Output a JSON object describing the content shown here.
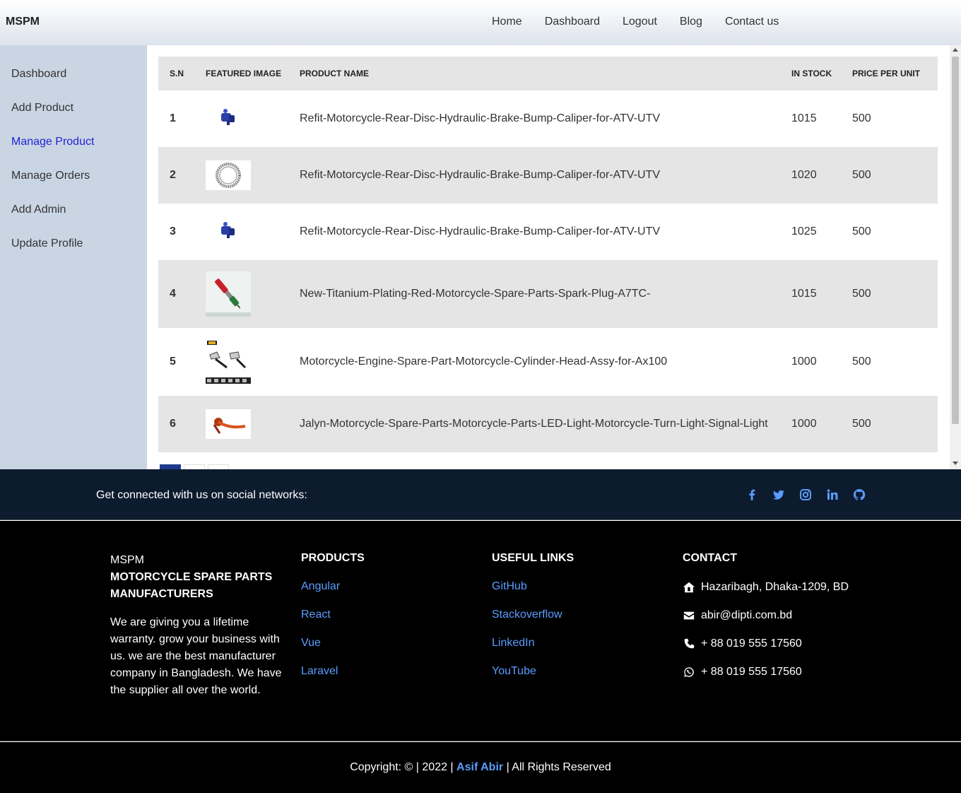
{
  "header": {
    "brand": "MSPM",
    "nav": [
      "Home",
      "Dashboard",
      "Logout",
      "Blog",
      "Contact us"
    ]
  },
  "sidebar": {
    "items": [
      "Dashboard",
      "Add Product",
      "Manage Product",
      "Manage Orders",
      "Add Admin",
      "Update Profile"
    ],
    "active": "Manage Product",
    "active_color": "#2323d6"
  },
  "table": {
    "headers": [
      "S.N",
      "FEATURED IMAGE",
      "PRODUCT NAME",
      "IN STOCK",
      "PRICE PER UNIT"
    ],
    "rows": [
      {
        "sn": "1",
        "image": "blue-brake-caliper",
        "name": "Refit-Motorcycle-Rear-Disc-Hydraulic-Brake-Bump-Caliper-for-ATV-UTV",
        "stock": "1015",
        "price": "500"
      },
      {
        "sn": "2",
        "image": "chain-ring",
        "name": "Refit-Motorcycle-Rear-Disc-Hydraulic-Brake-Bump-Caliper-for-ATV-UTV",
        "stock": "1020",
        "price": "500"
      },
      {
        "sn": "3",
        "image": "blue-brake-caliper",
        "name": "Refit-Motorcycle-Rear-Disc-Hydraulic-Brake-Bump-Caliper-for-ATV-UTV",
        "stock": "1025",
        "price": "500"
      },
      {
        "sn": "4",
        "image": "red-spark-plug",
        "name": "New-Titanium-Plating-Red-Motorcycle-Spare-Parts-Spark-Plug-A7TC-",
        "stock": "1015",
        "price": "500"
      },
      {
        "sn": "5",
        "image": "turn-signal-lights",
        "name": "Motorcycle-Engine-Spare-Part-Motorcycle-Cylinder-Head-Assy-for-Ax100",
        "stock": "1000",
        "price": "500"
      },
      {
        "sn": "6",
        "image": "orange-brake-lever",
        "name": "Jalyn-Motorcycle-Spare-Parts-Motorcycle-Parts-LED-Light-Motorcycle-Turn-Light-Signal-Light",
        "stock": "1000",
        "price": "500"
      }
    ]
  },
  "social": {
    "text": "Get connected with us on social networks:",
    "icons": [
      "facebook-icon",
      "twitter-icon",
      "instagram-icon",
      "linkedin-icon",
      "github-icon"
    ],
    "icon_color": "#5b9cff"
  },
  "footer": {
    "about": {
      "brand": "MSPM",
      "subtitle": "MOTORCYCLE SPARE PARTS MANUFACTURERS",
      "description": "We are giving you a lifetime warranty. grow your business with us. we are the best manufacturer company in Bangladesh. We have the supplier all over the world."
    },
    "products": {
      "heading": "PRODUCTS",
      "links": [
        "Angular",
        "React",
        "Vue",
        "Laravel"
      ]
    },
    "useful": {
      "heading": "USEFUL LINKS",
      "links": [
        "GitHub",
        "Stackoverflow",
        "LinkedIn",
        "YouTube"
      ]
    },
    "contact": {
      "heading": "CONTACT",
      "address": "Hazaribagh, Dhaka-1209, BD",
      "email": "abir@dipti.com.bd",
      "phone": "+ 88 019 555 17560",
      "whatsapp": "+ 88 019 555 17560"
    }
  },
  "copyright": {
    "prefix": "Copyright: © | 2022 |",
    "author": "Asif Abir",
    "suffix": "| All Rights Reserved"
  }
}
